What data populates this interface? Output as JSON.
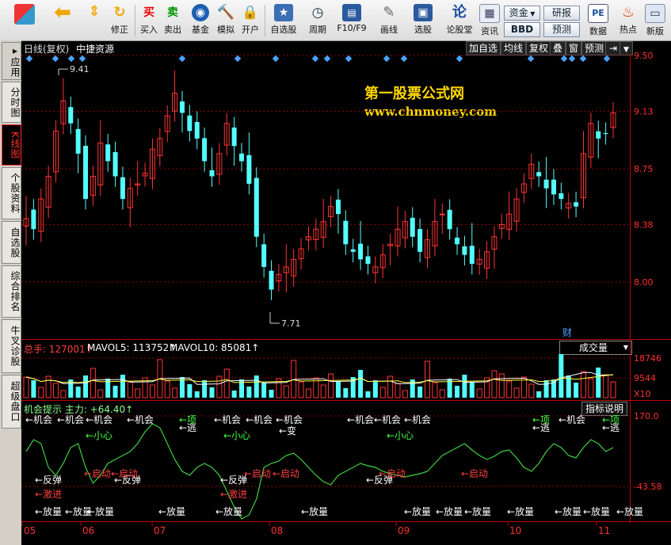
{
  "toolbar": {
    "buttons": [
      {
        "label": "",
        "icon": "app-grid-icon"
      },
      {
        "label": "",
        "icon": "back-arrow-icon"
      },
      {
        "label": "",
        "icon": "up-down-arrow-icon"
      },
      {
        "label": "修正",
        "icon": "refresh-icon"
      },
      {
        "label": "买入",
        "glyph": "买"
      },
      {
        "label": "卖出",
        "glyph": "卖"
      },
      {
        "label": "基金",
        "icon": "fund-icon"
      },
      {
        "label": "模拟",
        "icon": "hammer-icon"
      },
      {
        "label": "开户",
        "icon": "lock-icon"
      },
      {
        "label": "自选股",
        "icon": "star-folder-icon"
      },
      {
        "label": "周期",
        "icon": "clock-icon"
      },
      {
        "label": "F10/F9",
        "icon": "doc-icon"
      },
      {
        "label": "画线",
        "icon": "pen-icon"
      },
      {
        "label": "选股",
        "icon": "screen-icon"
      },
      {
        "label": "论股堂",
        "glyph": "论"
      },
      {
        "label": "资讯",
        "icon": "news-icon"
      },
      {
        "label": "数据",
        "glyph": "PE"
      },
      {
        "label": "热点",
        "icon": "fire-icon"
      },
      {
        "label": "新版",
        "icon": "new-version-icon"
      }
    ],
    "fund_label": "资金",
    "bbd_label": "BBD",
    "research_label": "研报",
    "forecast_label": "预测"
  },
  "sidebar": {
    "tabs": [
      "应用",
      "分时图",
      "K线图",
      "个股资料",
      "自选股",
      "综合排名",
      "牛叉诊股",
      "超级盘口"
    ]
  },
  "chart_header": {
    "period": "日线(复权)",
    "stock_name": "中捷资源",
    "menu": [
      "加自选",
      "均线",
      "复权",
      "叠",
      "窗",
      "预测"
    ]
  },
  "watermark": {
    "title": "第一股票公式网",
    "url": "www.chnmoney.com"
  },
  "price_panel": {
    "y_labels": [
      "9.50",
      "9.13",
      "8.75",
      "8.38",
      "8.00"
    ],
    "high_label": "9.41",
    "low_label": "7.71",
    "cai_label": "财"
  },
  "volume_panel": {
    "title": "总手: 127001↑",
    "mavol5": "MAVOL5: 113752↑",
    "mavol10": "MAVOL10: 85081↑",
    "selector": "成交量",
    "y_labels": [
      "18746",
      "9544",
      "X10"
    ]
  },
  "indicator_panel": {
    "title": "机会提示 主力: +64.40↑",
    "explain_button": "指标说明",
    "y_labels": [
      "170.0",
      "-43.58"
    ],
    "signals": [
      "机会",
      "项",
      "逃",
      "小心",
      "变",
      "反弹",
      "启动",
      "激进",
      "放量"
    ]
  },
  "x_axis": {
    "labels": [
      "05",
      "06",
      "07",
      "08",
      "09",
      "10",
      "11"
    ]
  },
  "colors": {
    "up": "#ff3333",
    "down": "#54ffff",
    "grid": "#8b0000",
    "axis": "#c00000"
  },
  "chart_data": {
    "type": "candlestick",
    "x": [
      "05",
      "06",
      "07",
      "08",
      "09",
      "10",
      "11"
    ],
    "ylim": [
      7.71,
      9.5
    ],
    "series": [
      {
        "name": "主力",
        "values": [
          64.4
        ]
      }
    ]
  }
}
